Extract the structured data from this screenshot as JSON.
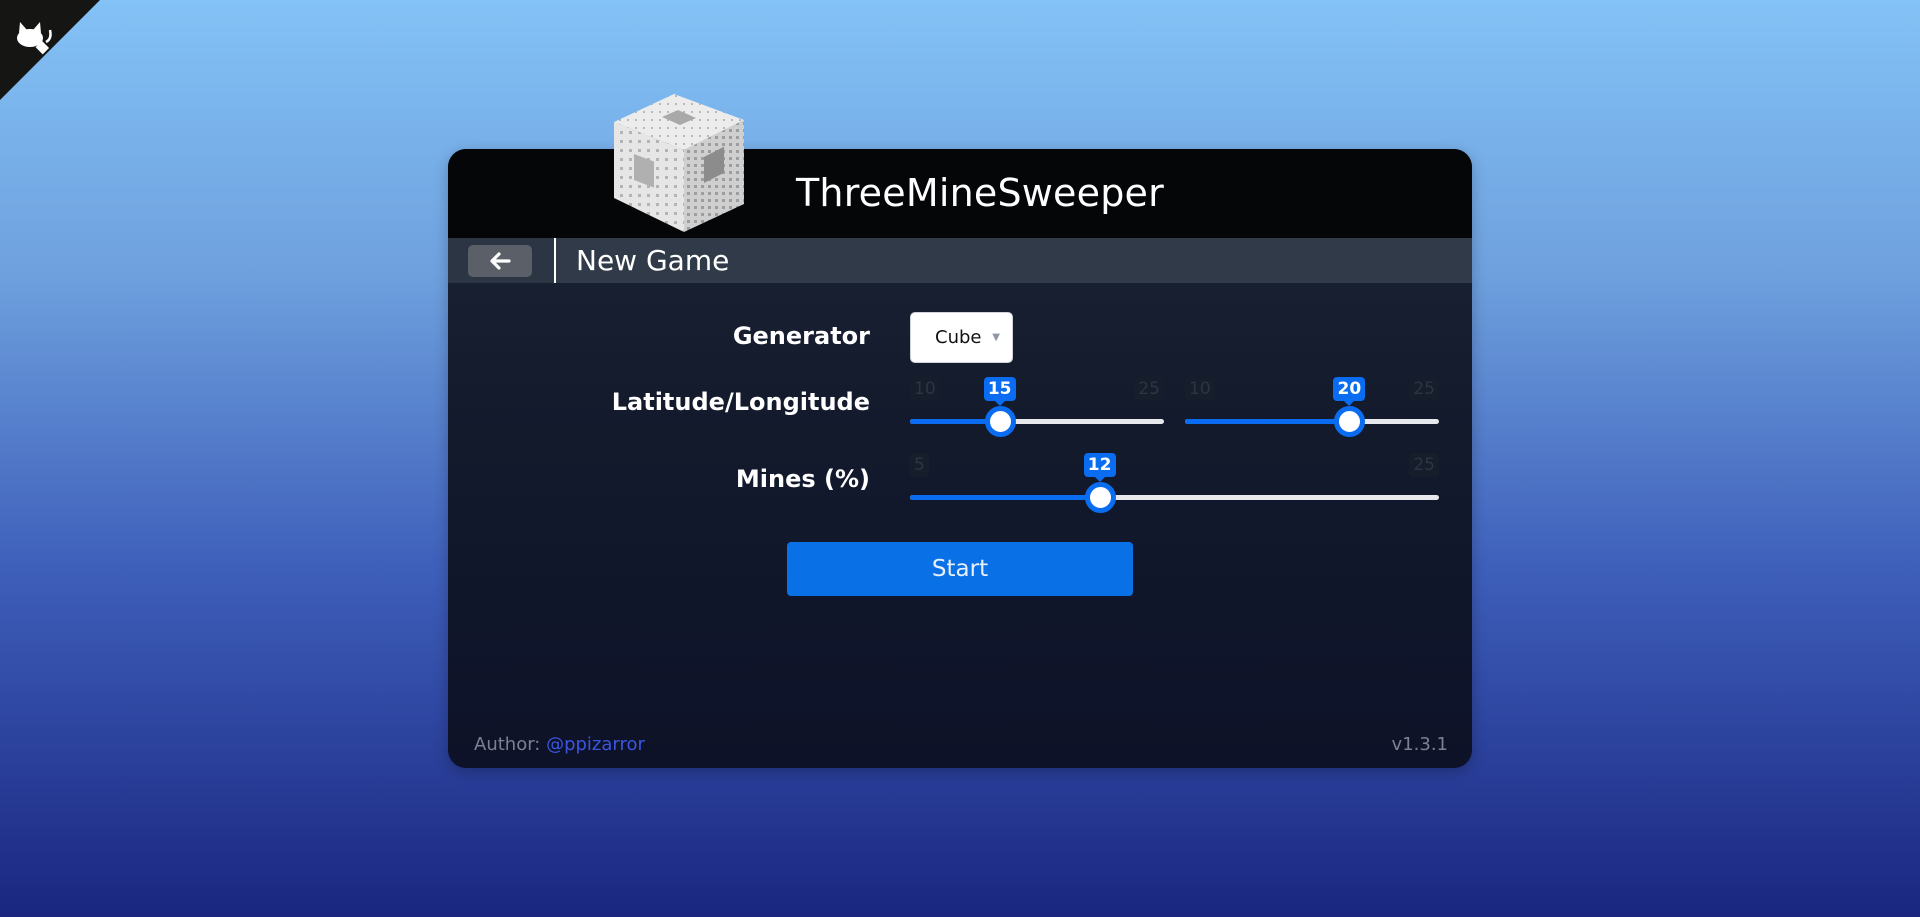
{
  "app": {
    "title": "ThreeMineSweeper",
    "github_corner_icon": "github-octocat-icon"
  },
  "subheader": {
    "back_icon": "arrow-left-icon",
    "page_title": "New Game"
  },
  "form": {
    "generator": {
      "label": "Generator",
      "selected": "Cube",
      "caret_icon": "chevron-down-icon"
    },
    "latlong": {
      "label": "Latitude/Longitude",
      "latitude": {
        "min": 10,
        "max": 25,
        "value": 15,
        "min_label": "10",
        "max_label": "25",
        "value_label": "15"
      },
      "longitude": {
        "min": 10,
        "max": 25,
        "value": 20,
        "min_label": "10",
        "max_label": "25",
        "value_label": "20"
      }
    },
    "mines": {
      "label": "Mines (%)",
      "slider": {
        "min": 5,
        "max": 25,
        "value": 12,
        "min_label": "5",
        "max_label": "25",
        "value_label": "12"
      }
    },
    "start_label": "Start"
  },
  "footer": {
    "author_prefix": "Author: ",
    "author_handle": "@ppizarror",
    "version": "v1.3.1"
  },
  "colors": {
    "accent": "#0a6cf0",
    "header_bg": "#050608",
    "subheader_bg": "#303a48",
    "link": "#3a56e0"
  }
}
